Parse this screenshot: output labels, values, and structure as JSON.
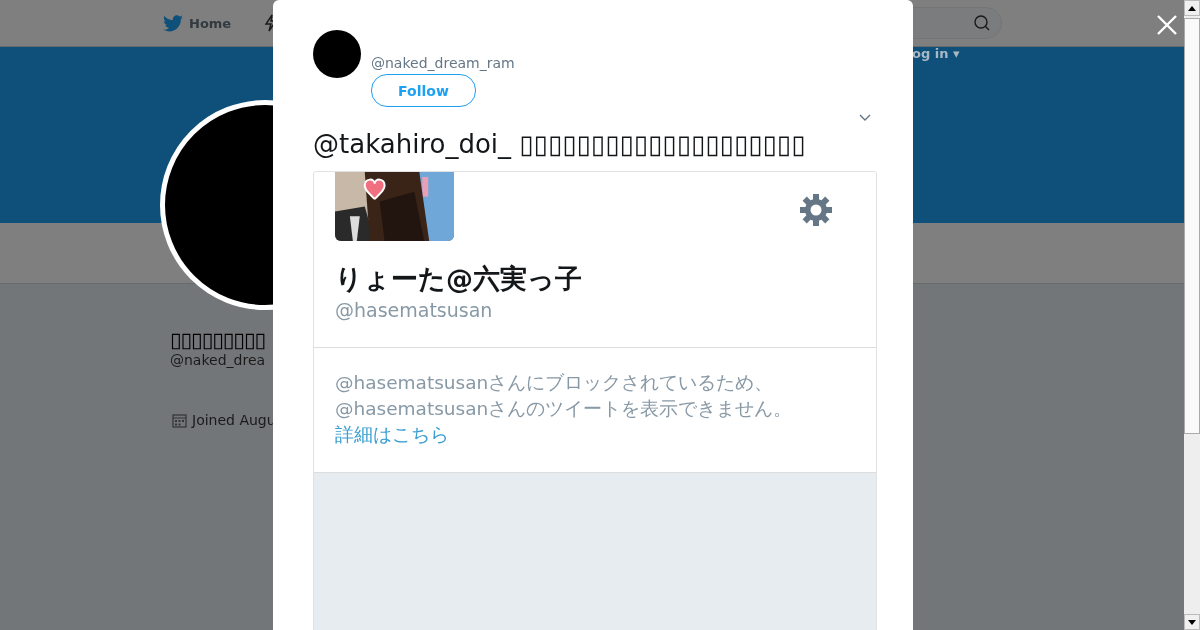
{
  "background_page": {
    "nav": {
      "home": "Home",
      "login": "og in ▾"
    },
    "profile": {
      "name": "▯▯▯▯▯▯▯▯▯",
      "handle": "@naked_drea",
      "joined": "Joined Augu"
    }
  },
  "modal": {
    "author": {
      "handle": "@naked_dream_ram",
      "follow_button": "Follow"
    },
    "tweet_text": "@takahiro_doi_ ▯▯▯▯▯▯▯▯▯▯▯▯▯▯▯▯▯▯▯▯",
    "embedded_screenshot": {
      "display_name": "りょーた@六実っ子",
      "handle": "@hasematsusan",
      "message": "@hasematsusanさんにブロックされているため、@hasematsusanさんのツイートを表示できません。",
      "link": "詳細はこちら"
    }
  }
}
